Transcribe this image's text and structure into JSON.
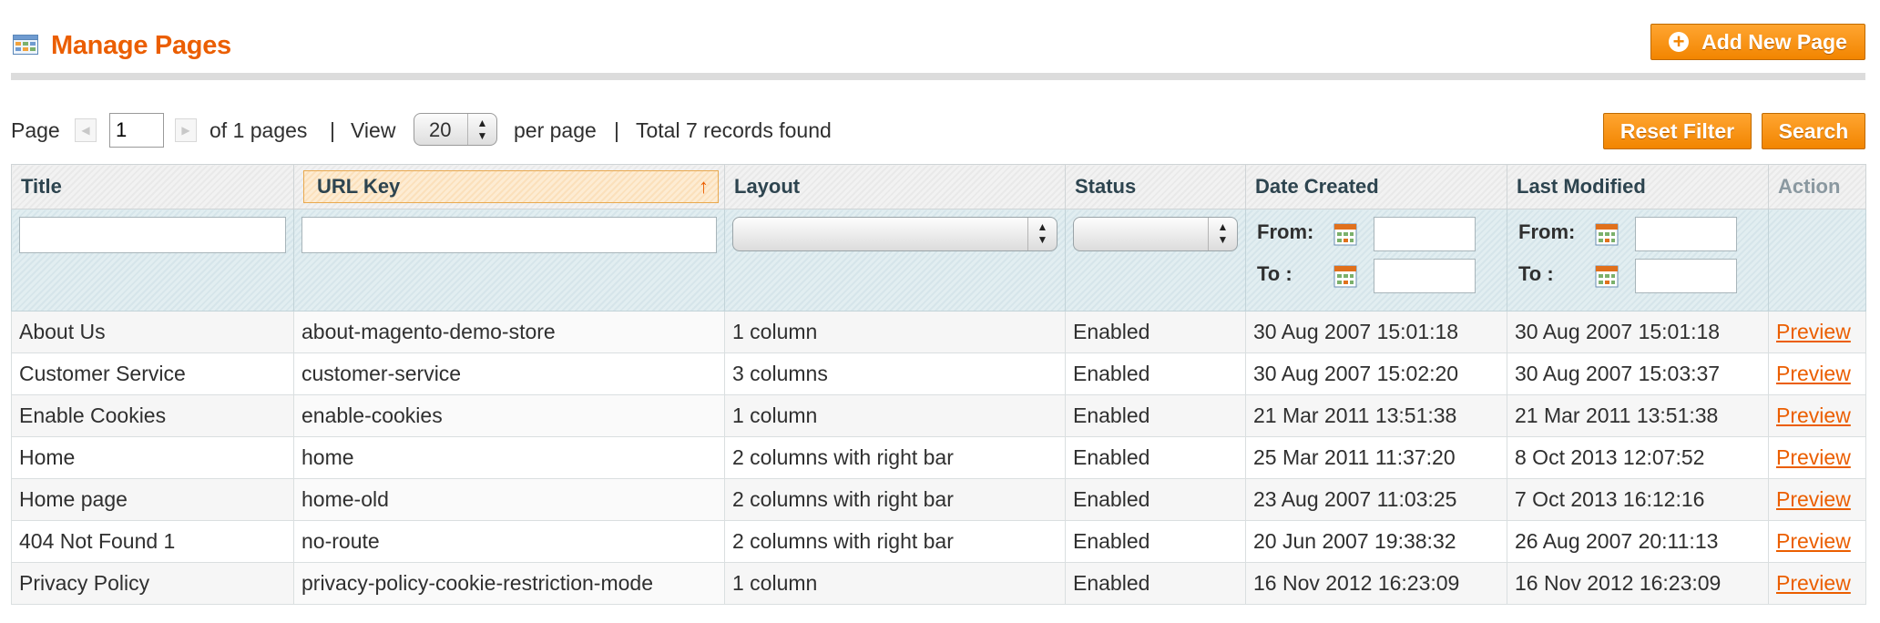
{
  "header": {
    "title": "Manage Pages",
    "add_button": "Add New Page"
  },
  "pager": {
    "page_label": "Page",
    "current_page": "1",
    "of_pages": "of 1 pages",
    "separator": "|",
    "view_label": "View",
    "per_page_value": "20",
    "per_page_label": "per page",
    "total_records": "Total 7 records found"
  },
  "actions": {
    "reset_filter": "Reset Filter",
    "search": "Search"
  },
  "columns": [
    {
      "label": "Title"
    },
    {
      "label": "URL Key",
      "sorted": "asc"
    },
    {
      "label": "Layout"
    },
    {
      "label": "Status"
    },
    {
      "label": "Date Created"
    },
    {
      "label": "Last Modified"
    },
    {
      "label": "Action"
    }
  ],
  "filters": {
    "from_label": "From:",
    "to_label": "To :"
  },
  "rows": [
    [
      "About Us",
      "about-magento-demo-store",
      "1 column",
      "Enabled",
      "30 Aug 2007 15:01:18",
      "30 Aug 2007 15:01:18",
      "Preview"
    ],
    [
      "Customer Service",
      "customer-service",
      "3 columns",
      "Enabled",
      "30 Aug 2007 15:02:20",
      "30 Aug 2007 15:03:37",
      "Preview"
    ],
    [
      "Enable Cookies",
      "enable-cookies",
      "1 column",
      "Enabled",
      "21 Mar 2011 13:51:38",
      "21 Mar 2011 13:51:38",
      "Preview"
    ],
    [
      "Home",
      "home",
      "2 columns with right bar",
      "Enabled",
      "25 Mar 2011 11:37:20",
      "8 Oct 2013 12:07:52",
      "Preview"
    ],
    [
      "Home page",
      "home-old",
      "2 columns with right bar",
      "Enabled",
      "23 Aug 2007 11:03:25",
      "7 Oct 2013 16:12:16",
      "Preview"
    ],
    [
      "404 Not Found 1",
      "no-route",
      "2 columns with right bar",
      "Enabled",
      "20 Jun 2007 19:38:32",
      "26 Aug 2007 20:11:13",
      "Preview"
    ],
    [
      "Privacy Policy",
      "privacy-policy-cookie-restriction-mode",
      "1 column",
      "Enabled",
      "16 Nov 2012 16:23:09",
      "16 Nov 2012 16:23:09",
      "Preview"
    ]
  ],
  "colors": {
    "accent": "#eb5e00",
    "button": "#f28500",
    "filter_bg": "#dce9ed"
  },
  "icons": {
    "title_icon": "grid-icon",
    "add_icon": "plus-circle-icon",
    "date_picker": "calendar-icon"
  }
}
